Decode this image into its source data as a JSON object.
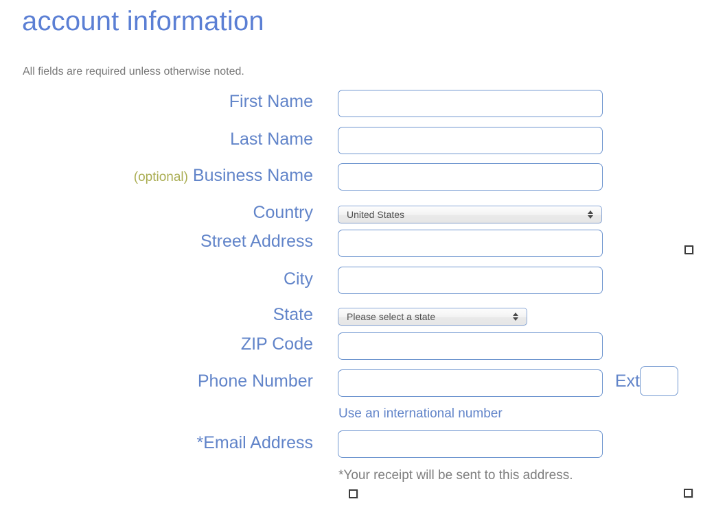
{
  "header": {
    "title": "account information",
    "note": "All fields are required unless otherwise noted."
  },
  "colors": {
    "title": "#5b7fd4",
    "label": "#6184c9",
    "optional": "#aaad52",
    "note": "#787878",
    "input_border": "#6e95cf",
    "select_border": "#8aa7d6"
  },
  "fields": {
    "first_name": {
      "label": "First Name",
      "value": "",
      "placeholder": ""
    },
    "last_name": {
      "label": "Last Name",
      "value": "",
      "placeholder": ""
    },
    "business_name": {
      "label": "Business Name",
      "optional_tag": "(optional)",
      "value": "",
      "placeholder": ""
    },
    "country": {
      "label": "Country",
      "selected": "United States"
    },
    "street_address": {
      "label": "Street Address",
      "value": "",
      "placeholder": ""
    },
    "city": {
      "label": "City",
      "value": "",
      "placeholder": ""
    },
    "state": {
      "label": "State",
      "selected": "Please select a state"
    },
    "zip_code": {
      "label": "ZIP Code",
      "value": "",
      "placeholder": ""
    },
    "phone_number": {
      "label": "Phone Number",
      "value": "",
      "placeholder": "",
      "ext_label": "Ext",
      "ext_value": "",
      "helper_link": "Use an international number"
    },
    "email_address": {
      "label": "Email Address",
      "star": "*",
      "value": "",
      "placeholder": "",
      "helper_note": "*Your receipt will be sent to this address."
    }
  }
}
